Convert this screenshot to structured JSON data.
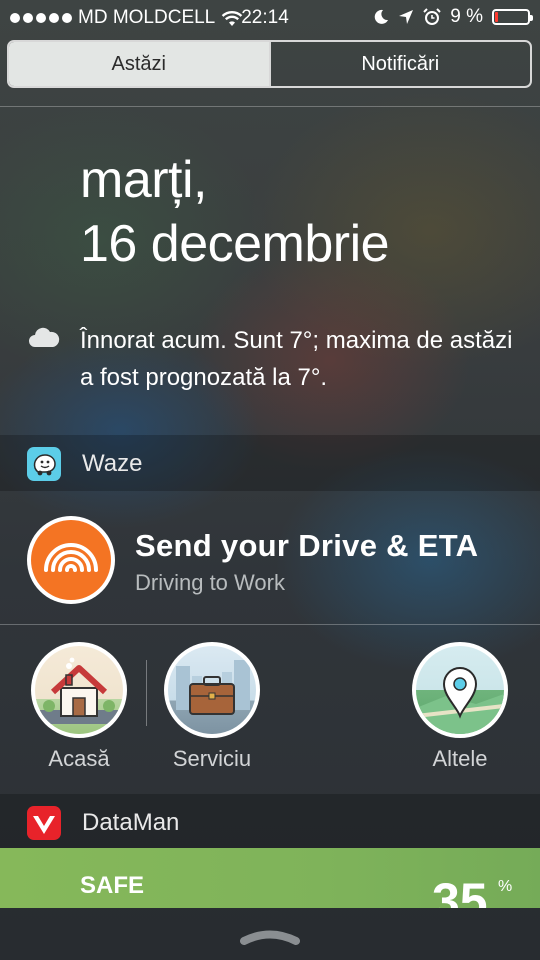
{
  "status_bar": {
    "carrier": "MD MOLDCELL",
    "time": "22:14",
    "battery_percent": "9 %",
    "battery_level": 0.09
  },
  "tabs": [
    {
      "label": "Astăzi",
      "active": true
    },
    {
      "label": "Notificări",
      "active": false
    }
  ],
  "today": {
    "weekday": "marți,",
    "date": "16 decembrie",
    "weather": "Înnorat acum. Sunt 7°; maxima de astăzi a fost prognozată la 7°."
  },
  "waze": {
    "header": "Waze",
    "title": "Send your Drive & ETA",
    "subtitle": "Driving to Work",
    "places": [
      {
        "label": "Acasă",
        "icon": "house-icon"
      },
      {
        "label": "Serviciu",
        "icon": "briefcase-icon"
      },
      {
        "label": "Altele",
        "icon": "map-pin-icon"
      }
    ]
  },
  "dataman": {
    "header": "DataMan",
    "status": "SAFE",
    "percent": "35",
    "percent_sign": "%"
  },
  "colors": {
    "waze_orange": "#f47423",
    "waze_blue": "#5ccde8",
    "dataman_red": "#e8232a",
    "safe_green": "#7fb35a",
    "battery_low": "#ff3b30"
  }
}
